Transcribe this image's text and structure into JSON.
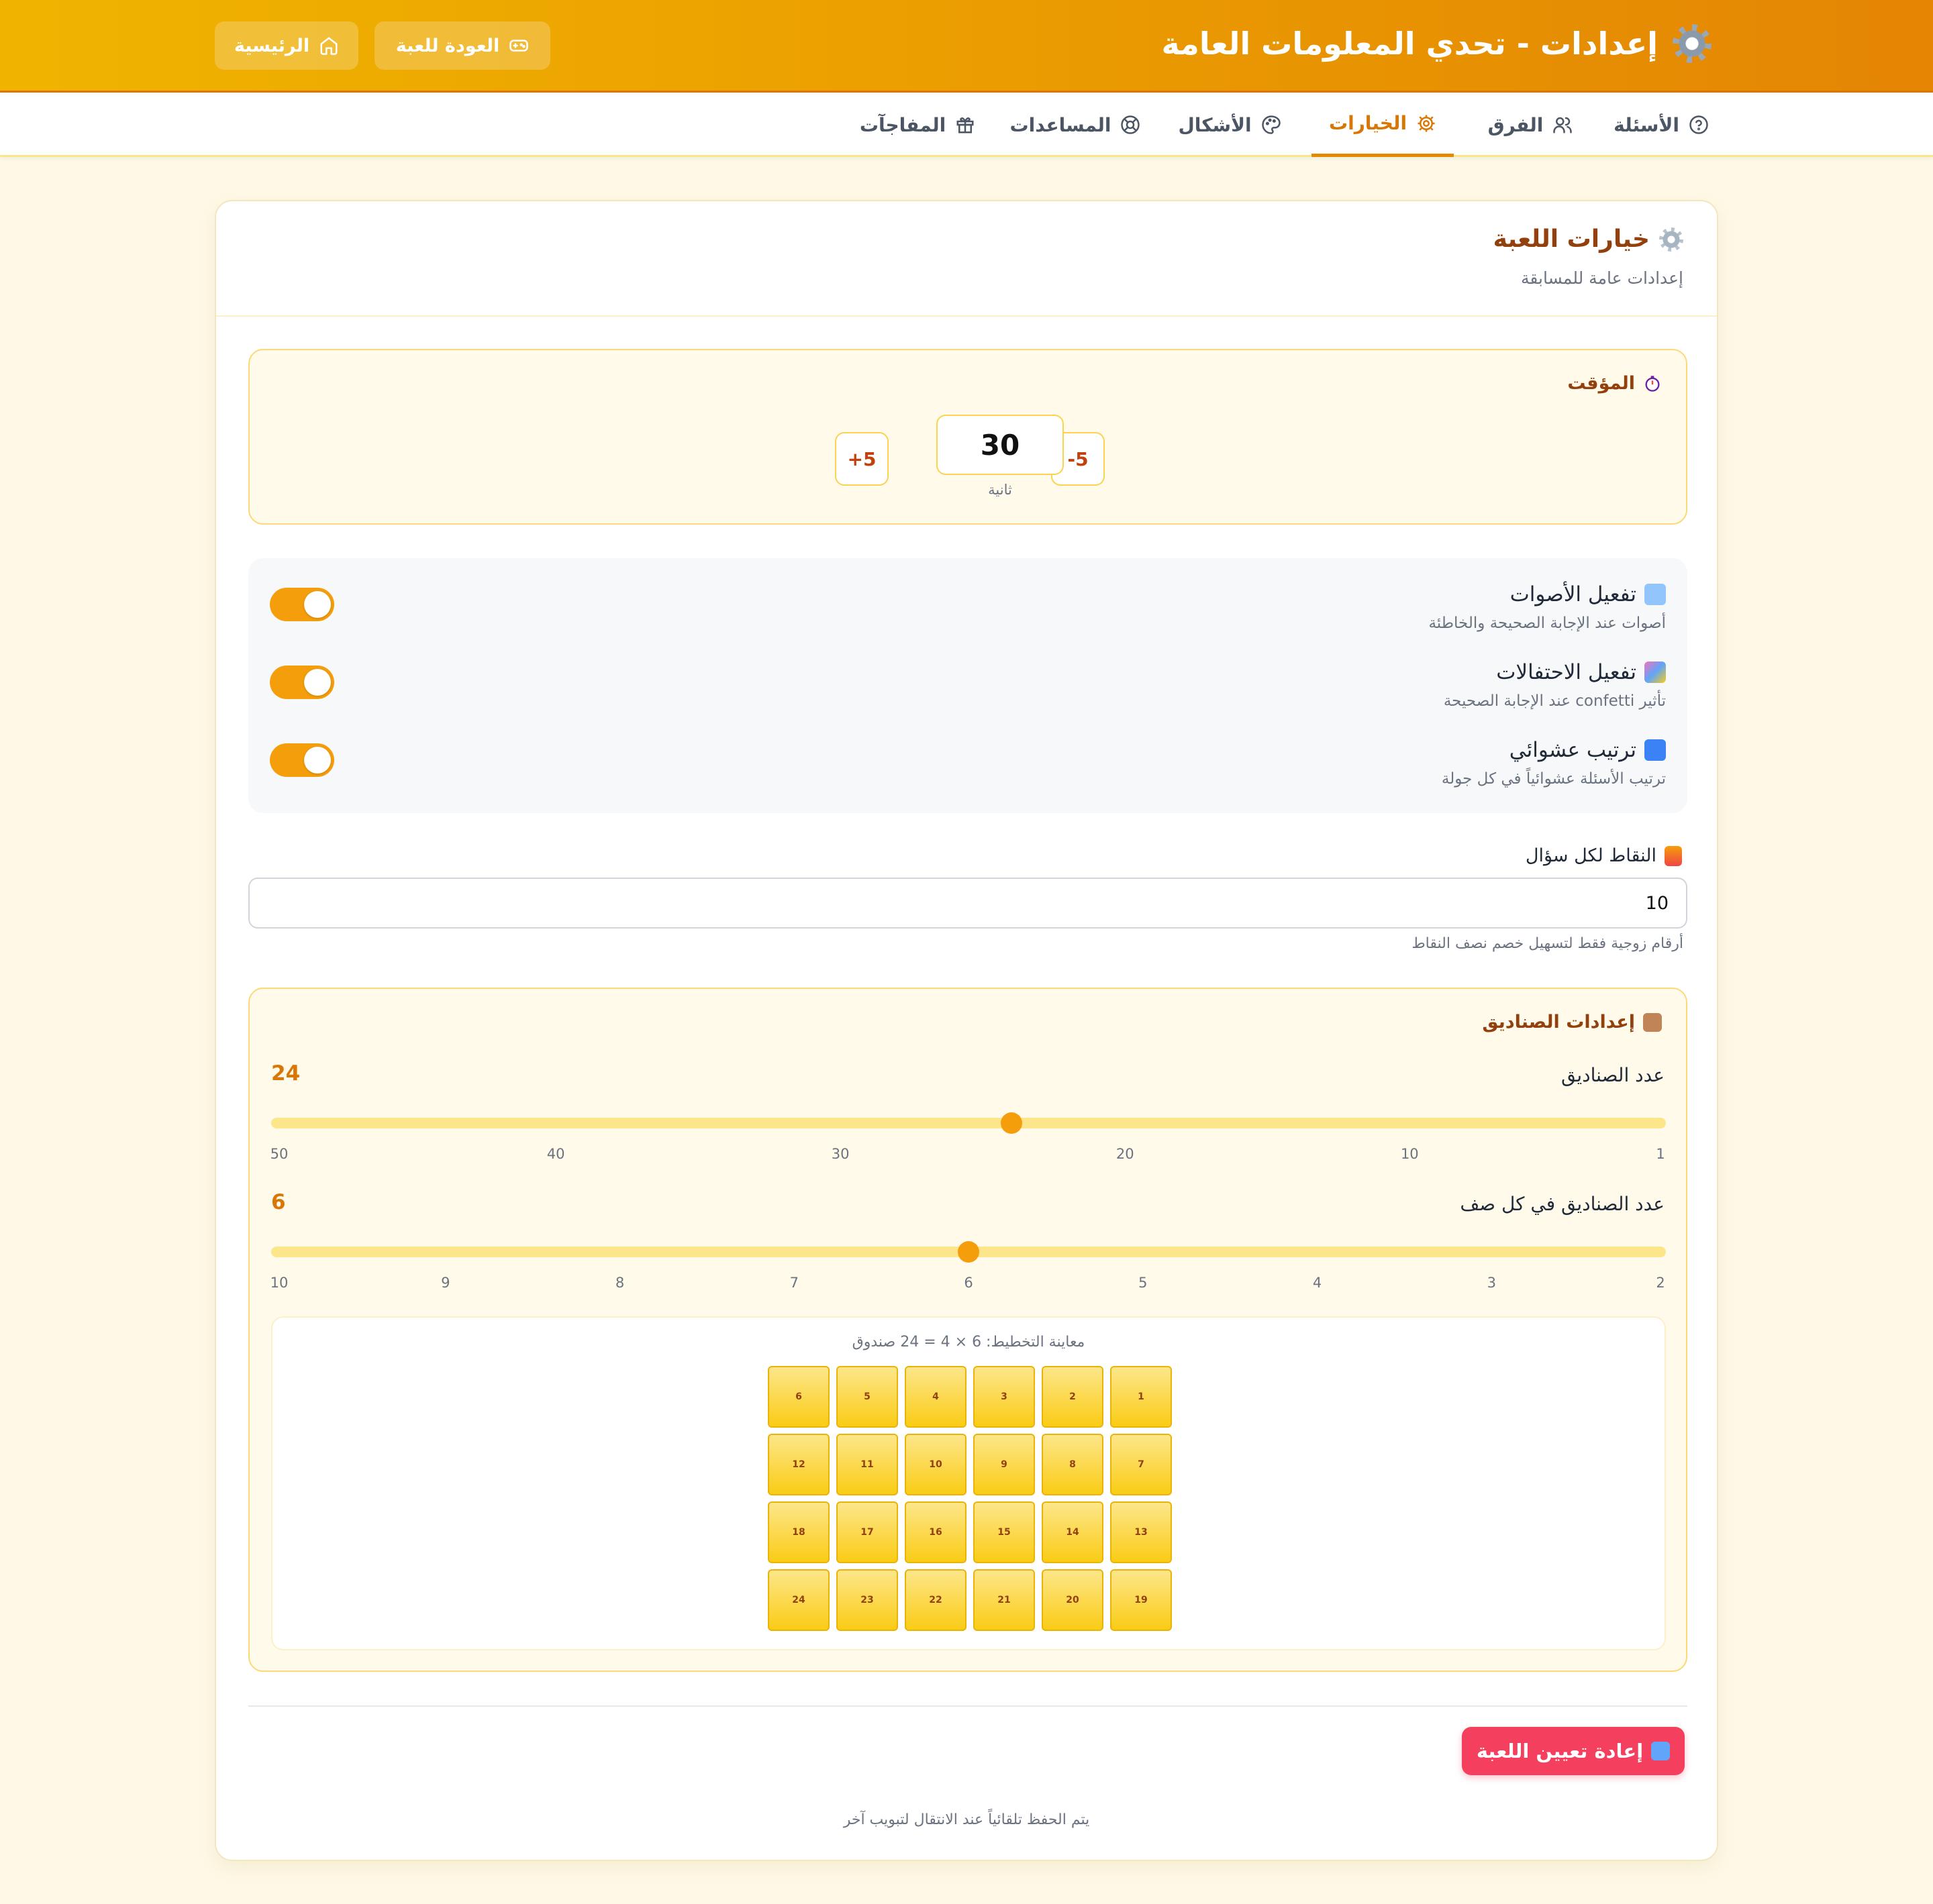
{
  "header": {
    "title": "إعدادات - تحدي المعلومات العامة",
    "back_button": "العودة للعبة",
    "home_button": "الرئيسية"
  },
  "tabs": [
    {
      "label": "الأسئلة",
      "icon": "help-circle-icon",
      "active": false
    },
    {
      "label": "الفرق",
      "icon": "users-icon",
      "active": false
    },
    {
      "label": "الخيارات",
      "icon": "settings-icon",
      "active": true
    },
    {
      "label": "الأشكال",
      "icon": "palette-icon",
      "active": false
    },
    {
      "label": "المساعدات",
      "icon": "lifebuoy-icon",
      "active": false
    },
    {
      "label": "المفاجآت",
      "icon": "gift-icon",
      "active": false
    }
  ],
  "card": {
    "title": "خيارات اللعبة",
    "subtitle": "إعدادات عامة للمسابقة"
  },
  "timer": {
    "label": "المؤقت",
    "value": "30",
    "unit": "ثانية",
    "decrease_label": "5-",
    "increase_label": "5+"
  },
  "toggles": [
    {
      "title": "تفعيل الأصوات",
      "desc": "أصوات عند الإجابة الصحيحة والخاطئة",
      "icon": "speaker-icon",
      "on": true
    },
    {
      "title": "تفعيل الاحتفالات",
      "desc": "تأثير confetti عند الإجابة الصحيحة",
      "icon": "celebration-icon",
      "on": true
    },
    {
      "title": "ترتيب عشوائي",
      "desc": "ترتيب الأسئلة عشوائياً في كل جولة",
      "icon": "shuffle-icon",
      "on": true
    }
  ],
  "points": {
    "label": "النقاط لكل سؤال",
    "value": "10",
    "hint": "أرقام زوجية فقط لتسهيل خصم نصف النقاط"
  },
  "boxes": {
    "label": "إعدادات الصناديق",
    "count_label": "عدد الصناديق",
    "count_value": "24",
    "count_min": 1,
    "count_max": 50,
    "count_ticks": [
      "1",
      "10",
      "20",
      "30",
      "40",
      "50"
    ],
    "per_row_label": "عدد الصناديق في كل صف",
    "per_row_value": "6",
    "per_row_min": 2,
    "per_row_max": 10,
    "per_row_ticks": [
      "2",
      "3",
      "4",
      "5",
      "6",
      "7",
      "8",
      "9",
      "10"
    ],
    "preview_caption": "معاينة التخطيط: 6 × 4 = 24 صندوق",
    "cells": [
      "1",
      "2",
      "3",
      "4",
      "5",
      "6",
      "7",
      "8",
      "9",
      "10",
      "11",
      "12",
      "13",
      "14",
      "15",
      "16",
      "17",
      "18",
      "19",
      "20",
      "21",
      "22",
      "23",
      "24"
    ]
  },
  "footer": {
    "reset_label": "إعادة تعيين اللعبة",
    "autosave_note": "يتم الحفظ تلقائياً عند الانتقال لتبويب آخر"
  },
  "colors": {
    "accent": "#f59e0b",
    "danger": "#f43f5e",
    "title_brown": "#92400e"
  }
}
